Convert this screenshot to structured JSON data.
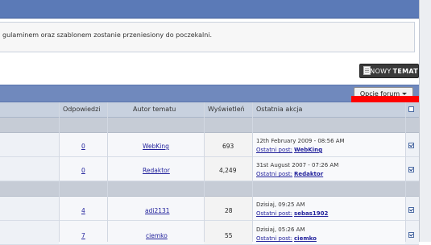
{
  "notice": {
    "text": "gulaminem oraz szablonem zostanie przeniesiony do poczekalni."
  },
  "buttons": {
    "new_topic_part1": "NOWY",
    "new_topic_part2": "TEMAT",
    "forum_options": "Opcje forum"
  },
  "columns": {
    "replies": "Odpowiedzi",
    "author": "Autor tematu",
    "views": "Wyświetleń",
    "last_action": "Ostatnia akcja"
  },
  "threads": [
    {
      "replies": "0",
      "author": "WebKing",
      "views": "693",
      "date": "12th February 2009 - 08:56 AM",
      "last_label": "Ostatni post:",
      "last_user": "WebKing"
    },
    {
      "replies": "0",
      "author": "Redaktor",
      "views": "4,249",
      "date": "31st August 2007 - 07:26 AM",
      "last_label": "Ostatni post:",
      "last_user": "Redaktor"
    },
    {
      "replies": "4",
      "author": "adi2131",
      "views": "28",
      "date": "Dzisiaj, 09:25 AM",
      "last_label": "Ostatni post:",
      "last_user": "sebas1902"
    },
    {
      "replies": "7",
      "author": "ciemko",
      "views": "55",
      "date": "Dzisiaj, 05:26 AM",
      "last_label": "Ostatni post:",
      "last_user": "ciemko"
    }
  ],
  "icons": {
    "new_topic": "document-icon",
    "options": "chevron-down-icon",
    "row_select": "checkbox-icon"
  },
  "colors": {
    "header_blue": "#7089bd",
    "link": "#22229c",
    "highlight_red": "#ff0000"
  }
}
